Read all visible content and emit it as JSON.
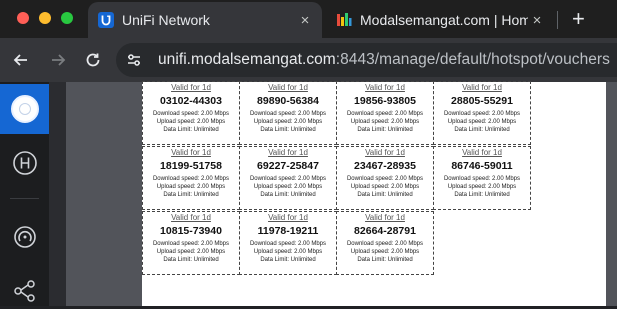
{
  "browser": {
    "tabs": [
      {
        "title": "UniFi Network",
        "active": true,
        "icon": "unifi-favicon"
      },
      {
        "title": "Modalsemangat.com | Homep",
        "active": false,
        "icon": "site-favicon"
      }
    ],
    "new_tab_label": "+",
    "close_glyph": "×",
    "url_host": "unifi.modalsemangat.com",
    "url_rest": ":8443/manage/default/hotspot/vouchers"
  },
  "sidebar": {
    "items": [
      {
        "name": "unifi-logo",
        "icon": "unifi-device-icon"
      },
      {
        "name": "hotspot",
        "icon": "hotspot-h-icon"
      },
      {
        "name": "insights",
        "icon": "insights-icon"
      },
      {
        "name": "topology",
        "icon": "topology-icon"
      }
    ]
  },
  "vouchers": [
    {
      "valid": "Valid for 1d",
      "code": "03102-44303",
      "down": "Download speed: 2.00 Mbps",
      "up": "Upload speed: 2.00 Mbps",
      "limit": "Data Limit: Unlimited"
    },
    {
      "valid": "Valid for 1d",
      "code": "89890-56384",
      "down": "Download speed: 2.00 Mbps",
      "up": "Upload speed: 2.00 Mbps",
      "limit": "Data Limit: Unlimited"
    },
    {
      "valid": "Valid for 1d",
      "code": "19856-93805",
      "down": "Download speed: 2.00 Mbps",
      "up": "Upload speed: 2.00 Mbps",
      "limit": "Data Limit: Unlimited"
    },
    {
      "valid": "Valid for 1d",
      "code": "28805-55291",
      "down": "Download speed: 2.00 Mbps",
      "up": "Upload speed: 2.00 Mbps",
      "limit": "Data Limit: Unlimited"
    },
    {
      "valid": "Valid for 1d",
      "code": "18199-51758",
      "down": "Download speed: 2.00 Mbps",
      "up": "Upload speed: 2.00 Mbps",
      "limit": "Data Limit: Unlimited"
    },
    {
      "valid": "Valid for 1d",
      "code": "69227-25847",
      "down": "Download speed: 2.00 Mbps",
      "up": "Upload speed: 2.00 Mbps",
      "limit": "Data Limit: Unlimited"
    },
    {
      "valid": "Valid for 1d",
      "code": "23467-28935",
      "down": "Download speed: 2.00 Mbps",
      "up": "Upload speed: 2.00 Mbps",
      "limit": "Data Limit: Unlimited"
    },
    {
      "valid": "Valid for 1d",
      "code": "86746-59011",
      "down": "Download speed: 2.00 Mbps",
      "up": "Upload speed: 2.00 Mbps",
      "limit": "Data Limit: Unlimited"
    },
    {
      "valid": "Valid for 1d",
      "code": "10815-73940",
      "down": "Download speed: 2.00 Mbps",
      "up": "Upload speed: 2.00 Mbps",
      "limit": "Data Limit: Unlimited"
    },
    {
      "valid": "Valid for 1d",
      "code": "11978-19211",
      "down": "Download speed: 2.00 Mbps",
      "up": "Upload speed: 2.00 Mbps",
      "limit": "Data Limit: Unlimited"
    },
    {
      "valid": "Valid for 1d",
      "code": "82664-28791",
      "down": "Download speed: 2.00 Mbps",
      "up": "Upload speed: 2.00 Mbps",
      "limit": "Data Limit: Unlimited"
    }
  ],
  "colors": {
    "accent": "#1567d3",
    "tab_active": "#35363a",
    "page_bg": "#52545a"
  }
}
